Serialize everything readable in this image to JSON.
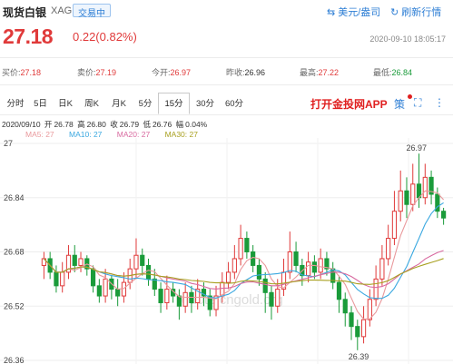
{
  "header": {
    "title": "现货白银",
    "symbol": "XAG",
    "status": "交易中",
    "currency_btn": "美元/盎司",
    "refresh_btn": "刷新行情"
  },
  "quote": {
    "price": "27.18",
    "change": "0.22(0.82%)",
    "timestamp": "2020-09-10  18:05:17"
  },
  "stats": {
    "buy_label": "买价:",
    "buy": "27.18",
    "sell_label": "卖价:",
    "sell": "27.19",
    "open_label": "今开:",
    "open": "26.97",
    "prev_label": "昨收:",
    "prev": "26.96",
    "high_label": "最高:",
    "high": "27.22",
    "low_label": "最低:",
    "low": "26.84"
  },
  "tabs": [
    "分时",
    "5日",
    "日K",
    "周K",
    "月K",
    "5分",
    "15分",
    "30分",
    "60分"
  ],
  "active_tab": "15分",
  "promo": "打开金投网APP",
  "tools": {
    "strategy": "策"
  },
  "ohlc_line": {
    "date": "2020/09/10",
    "open_label": "开",
    "open": "26.78",
    "high_label": "高",
    "high": "26.80",
    "close_label": "收",
    "close": "26.79",
    "low_label": "低",
    "low": "26.76",
    "amp_label": "幅",
    "amp": "0.04%"
  },
  "ma_legend": {
    "ma5": "MA5: 27",
    "ma10": "MA10: 27",
    "ma20": "MA20: 27",
    "ma30": "MA30: 27"
  },
  "colors": {
    "up": "#e03a3a",
    "down": "#1a9b3a",
    "ma5": "#e9999c",
    "ma10": "#3aa8e0",
    "ma20": "#d86aa0",
    "ma30": "#a8a020",
    "accent": "#2f7fd5"
  },
  "watermark": "quote.cngold.org",
  "chart_data": {
    "type": "candlestick",
    "y_ticks": [
      "27",
      "26.84",
      "26.68",
      "26.52",
      "26.36"
    ],
    "ylim": [
      26.36,
      27.0
    ],
    "annotations": {
      "max": "26.97",
      "min": "26.39"
    },
    "candles": [
      [
        26.64,
        26.66,
        26.6,
        26.68
      ],
      [
        26.66,
        26.62,
        26.6,
        26.68
      ],
      [
        26.62,
        26.58,
        26.56,
        26.64
      ],
      [
        26.58,
        26.62,
        26.56,
        26.65
      ],
      [
        26.62,
        26.67,
        26.6,
        26.7
      ],
      [
        26.67,
        26.64,
        26.62,
        26.7
      ],
      [
        26.64,
        26.66,
        26.62,
        26.68
      ],
      [
        26.66,
        26.63,
        26.61,
        26.67
      ],
      [
        26.63,
        26.58,
        26.56,
        26.64
      ],
      [
        26.58,
        26.55,
        26.53,
        26.6
      ],
      [
        26.55,
        26.6,
        26.53,
        26.63
      ],
      [
        26.6,
        26.57,
        26.54,
        26.61
      ],
      [
        26.57,
        26.55,
        26.52,
        26.6
      ],
      [
        26.55,
        26.59,
        26.53,
        26.62
      ],
      [
        26.59,
        26.63,
        26.57,
        26.66
      ],
      [
        26.63,
        26.67,
        26.6,
        26.72
      ],
      [
        26.67,
        26.64,
        26.61,
        26.69
      ],
      [
        26.64,
        26.6,
        26.58,
        26.66
      ],
      [
        26.6,
        26.57,
        26.55,
        26.63
      ],
      [
        26.57,
        26.53,
        26.5,
        26.59
      ],
      [
        26.53,
        26.57,
        26.51,
        26.61
      ],
      [
        26.57,
        26.55,
        26.53,
        26.59
      ],
      [
        26.55,
        26.52,
        26.48,
        26.57
      ],
      [
        26.52,
        26.56,
        26.5,
        26.59
      ],
      [
        26.56,
        26.53,
        26.5,
        26.58
      ],
      [
        26.53,
        26.57,
        26.51,
        26.6
      ],
      [
        26.57,
        26.55,
        26.52,
        26.59
      ],
      [
        26.55,
        26.51,
        26.49,
        26.57
      ],
      [
        26.51,
        26.55,
        26.49,
        26.58
      ],
      [
        26.55,
        26.59,
        26.53,
        26.62
      ],
      [
        26.59,
        26.62,
        26.57,
        26.65
      ],
      [
        26.62,
        26.66,
        26.6,
        26.7
      ],
      [
        26.66,
        26.72,
        26.64,
        26.76
      ],
      [
        26.72,
        26.68,
        26.66,
        26.74
      ],
      [
        26.68,
        26.64,
        26.62,
        26.7
      ],
      [
        26.64,
        26.6,
        26.58,
        26.66
      ],
      [
        26.6,
        26.56,
        26.5,
        26.62
      ],
      [
        26.56,
        26.52,
        26.48,
        26.58
      ],
      [
        26.52,
        26.57,
        26.5,
        26.6
      ],
      [
        26.57,
        26.62,
        26.55,
        26.66
      ],
      [
        26.62,
        26.68,
        26.6,
        26.74
      ],
      [
        26.68,
        26.64,
        26.62,
        26.71
      ],
      [
        26.64,
        26.61,
        26.58,
        26.66
      ],
      [
        26.61,
        26.65,
        26.59,
        26.68
      ],
      [
        26.65,
        26.62,
        26.6,
        26.67
      ],
      [
        26.62,
        26.66,
        26.6,
        26.69
      ],
      [
        26.66,
        26.63,
        26.61,
        26.68
      ],
      [
        26.63,
        26.59,
        26.57,
        26.65
      ],
      [
        26.59,
        26.54,
        26.5,
        26.61
      ],
      [
        26.54,
        26.5,
        26.46,
        26.56
      ],
      [
        26.5,
        26.46,
        26.42,
        26.52
      ],
      [
        26.46,
        26.43,
        26.39,
        26.48
      ],
      [
        26.43,
        26.48,
        26.41,
        26.52
      ],
      [
        26.48,
        26.54,
        26.46,
        26.57
      ],
      [
        26.54,
        26.6,
        26.52,
        26.64
      ],
      [
        26.6,
        26.66,
        26.58,
        26.7
      ],
      [
        26.66,
        26.72,
        26.64,
        26.76
      ],
      [
        26.72,
        26.8,
        26.7,
        26.86
      ],
      [
        26.8,
        26.86,
        26.77,
        26.92
      ],
      [
        26.86,
        26.82,
        26.78,
        26.9
      ],
      [
        26.82,
        26.88,
        26.8,
        26.94
      ],
      [
        26.88,
        26.84,
        26.81,
        26.97
      ],
      [
        26.84,
        26.9,
        26.82,
        26.94
      ],
      [
        26.9,
        26.85,
        26.82,
        26.92
      ],
      [
        26.85,
        26.8,
        26.78,
        26.87
      ],
      [
        26.8,
        26.78,
        26.76,
        26.81
      ]
    ]
  }
}
